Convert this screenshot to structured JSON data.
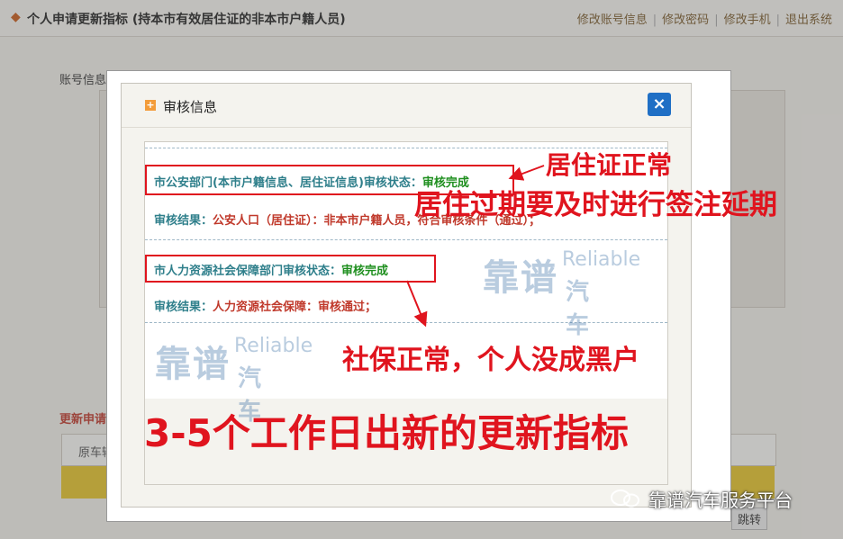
{
  "background": {
    "page_title": "个人申请更新指标 (持本市有效居住证的非本市户籍人员)",
    "nav": [
      "修改账号信息",
      "修改密码",
      "修改手机",
      "退出系统"
    ],
    "account_section_label": "账号信息",
    "update_section_label": "更新申请",
    "field_label": "原车辆",
    "jump_button": "跳转"
  },
  "modal": {
    "title": "审核信息",
    "close_label": "×",
    "sections": [
      {
        "status_label": "市公安部门(本市户籍信息、居住证信息)审核状态：",
        "status_value": "审核完成",
        "result_label": "审核结果：",
        "result_value": "公安人口（居住证）：非本市户籍人员，符合审核条件（通过）；"
      },
      {
        "status_label": "市人力资源社会保障部门审核状态：",
        "status_value": "审核完成",
        "result_label": "审核结果：",
        "result_value": "人力资源社会保障：审核通过；"
      }
    ]
  },
  "watermark": {
    "cn_big": "靠谱",
    "en": "Reliable",
    "cn_small": "汽车"
  },
  "annotations": {
    "residence_ok": "居住证正常",
    "residence_expire": "居住过期要及时进行签注延期",
    "social_security_ok": "社保正常，个人没成黑户",
    "new_quota": "3-5个工作日出新的更新指标"
  },
  "brand": "靠谱汽车服务平台",
  "colors": {
    "annotation_red": "#e0141e",
    "status_done_green": "#1f8f1f",
    "label_teal": "#2f7f8b",
    "close_blue": "#1f6fc5"
  }
}
